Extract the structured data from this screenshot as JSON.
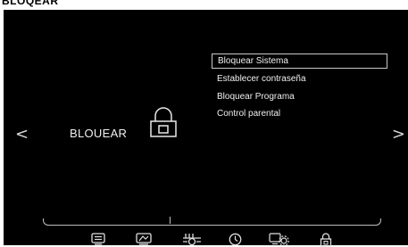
{
  "page_heading": "BLOQEAR",
  "screen": {
    "section_title": "BLOUEAR",
    "left_arrow": "<",
    "right_arrow": ">"
  },
  "menu": {
    "items": [
      {
        "label": "Bloquear Sistema",
        "selected": true
      },
      {
        "label": "Establecer contraseña",
        "selected": false
      },
      {
        "label": "Bloquear Programa",
        "selected": false
      },
      {
        "label": "Control parental",
        "selected": false
      }
    ]
  },
  "bottom_nav": [
    {
      "icon": "picture-icon"
    },
    {
      "icon": "sound-icon"
    },
    {
      "icon": "channel-icon"
    },
    {
      "icon": "clock-icon"
    },
    {
      "icon": "settings-icon"
    },
    {
      "icon": "lock-icon",
      "active": true
    }
  ],
  "colors": {
    "background": "#000000",
    "text": "#f0f0f0",
    "highlight_border": "#c8c8c8"
  }
}
